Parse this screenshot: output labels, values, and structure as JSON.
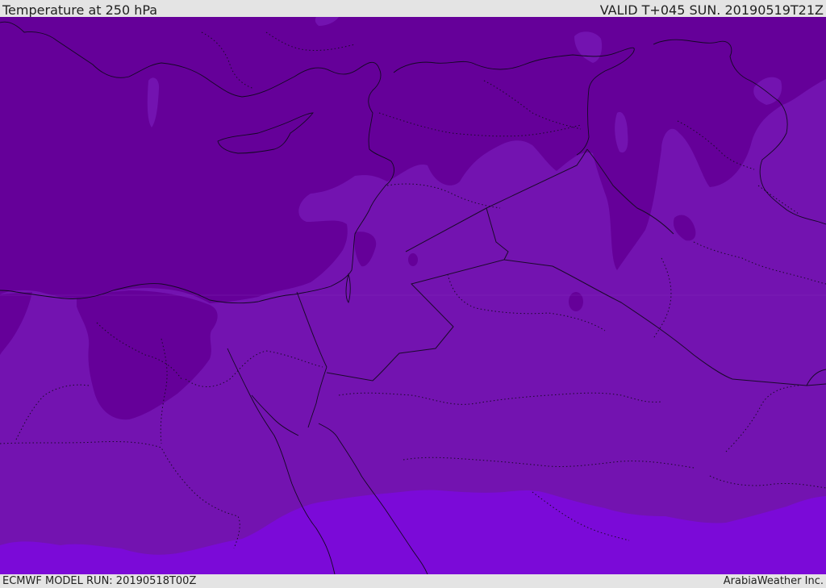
{
  "header": {
    "title": "Temperature at 250 hPa",
    "valid_time": "VALID T+045 SUN. 20190519T21Z"
  },
  "footer": {
    "model_run": "ECMWF MODEL RUN: 20190518T00Z",
    "credit": "ArabiaWeather Inc."
  },
  "colors": {
    "band_dark": "#650099",
    "band_mid": "#7313b0",
    "band_light": "#7b0ad8",
    "frame": "#e4e4e4",
    "lines": "#1a0a2a"
  }
}
